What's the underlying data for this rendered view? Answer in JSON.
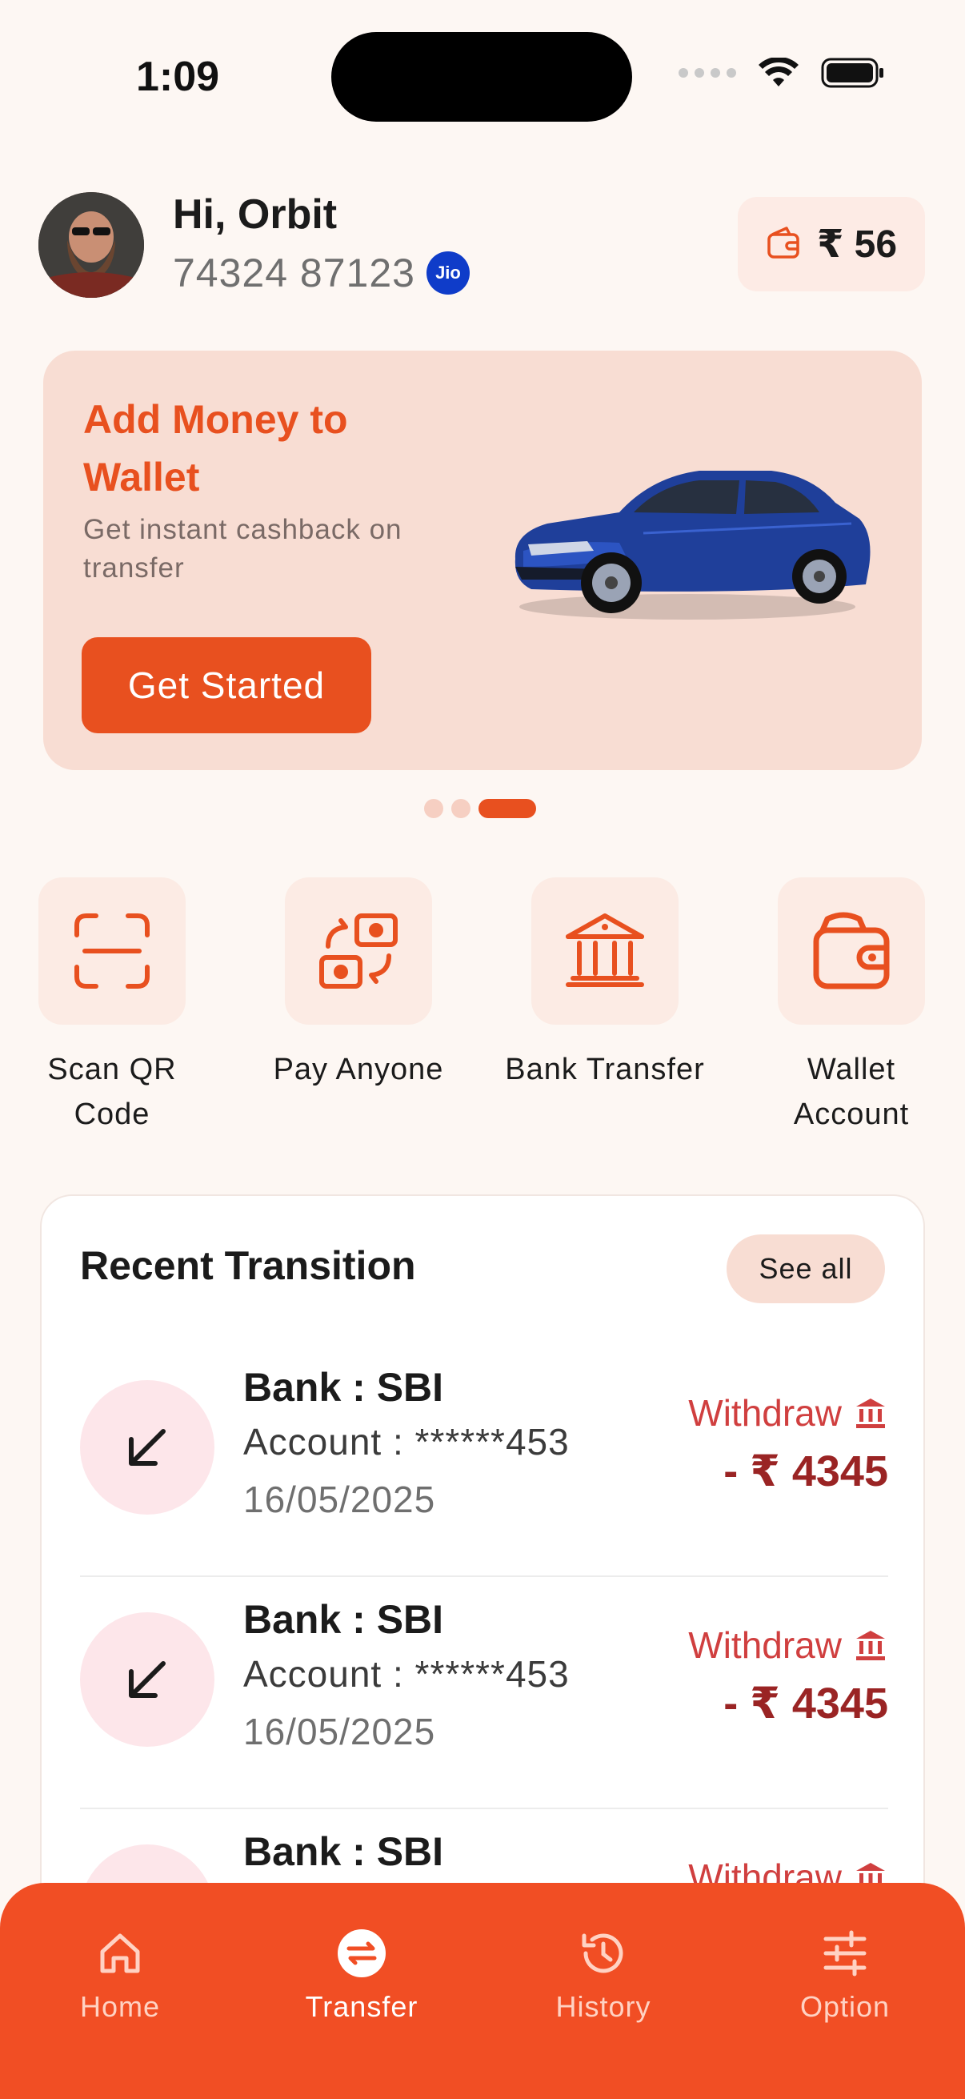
{
  "status_bar": {
    "time": "1:09"
  },
  "header": {
    "greeting": "Hi, Orbit",
    "phone": "74324 87123",
    "carrier_badge": "Jio",
    "wallet_balance": "₹ 56"
  },
  "promo": {
    "title": "Add Money to Wallet",
    "subtitle": "Get instant cashback on transfer",
    "button_label": "Get Started",
    "carousel": {
      "count": 3,
      "active_index": 2
    }
  },
  "quick_actions": [
    {
      "label": "Scan QR Code",
      "icon": "scan-qr-icon"
    },
    {
      "label": "Pay Anyone",
      "icon": "pay-anyone-icon"
    },
    {
      "label": "Bank Transfer",
      "icon": "bank-icon"
    },
    {
      "label": "Wallet Account",
      "icon": "wallet-icon"
    }
  ],
  "recent": {
    "title": "Recent Transition",
    "see_all": "See all",
    "transactions": [
      {
        "bank": "Bank : SBI",
        "account": "Account : ******453",
        "date": "16/05/2025",
        "type": "Withdraw",
        "amount": "- ₹ 4345"
      },
      {
        "bank": "Bank : SBI",
        "account": "Account : ******453",
        "date": "16/05/2025",
        "type": "Withdraw",
        "amount": "- ₹ 4345"
      },
      {
        "bank": "Bank : SBI",
        "account": "",
        "date": "",
        "type": "Withdraw",
        "amount": ""
      }
    ]
  },
  "bottom_nav": {
    "items": [
      {
        "label": "Home",
        "icon": "home-icon"
      },
      {
        "label": "Transfer",
        "icon": "transfer-icon"
      },
      {
        "label": "History",
        "icon": "history-icon"
      },
      {
        "label": "Option",
        "icon": "options-icon"
      }
    ],
    "active": "Transfer"
  },
  "colors": {
    "accent": "#e8501f",
    "nav_background": "#f14e24",
    "promo_background": "#f8ddd3",
    "withdraw_text": "#d03f3f",
    "amount_text": "#9a2424"
  }
}
